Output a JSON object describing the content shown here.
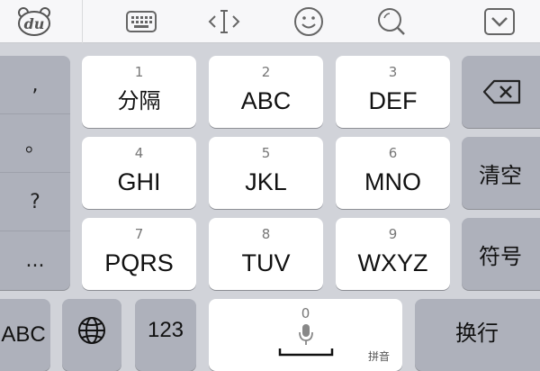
{
  "toolbar": {
    "logo_text": "du",
    "icons": [
      "keyboard-icon",
      "cursor-move-icon",
      "emoji-icon",
      "search-icon",
      "hide-keyboard-icon"
    ]
  },
  "side_punctuation": [
    ",",
    "。",
    "?",
    "..."
  ],
  "keys": [
    {
      "num": "1",
      "label": "分隔"
    },
    {
      "num": "2",
      "label": "ABC"
    },
    {
      "num": "3",
      "label": "DEF"
    },
    {
      "num": "4",
      "label": "GHI"
    },
    {
      "num": "5",
      "label": "JKL"
    },
    {
      "num": "6",
      "label": "MNO"
    },
    {
      "num": "7",
      "label": "PQRS"
    },
    {
      "num": "8",
      "label": "TUV"
    },
    {
      "num": "9",
      "label": "WXYZ"
    }
  ],
  "right_keys": {
    "clear": "清空",
    "symbols": "符号"
  },
  "bottom": {
    "abc": "ABC",
    "num123": "123",
    "space_num": "0",
    "space_hint": "拼音",
    "enter": "换行"
  }
}
